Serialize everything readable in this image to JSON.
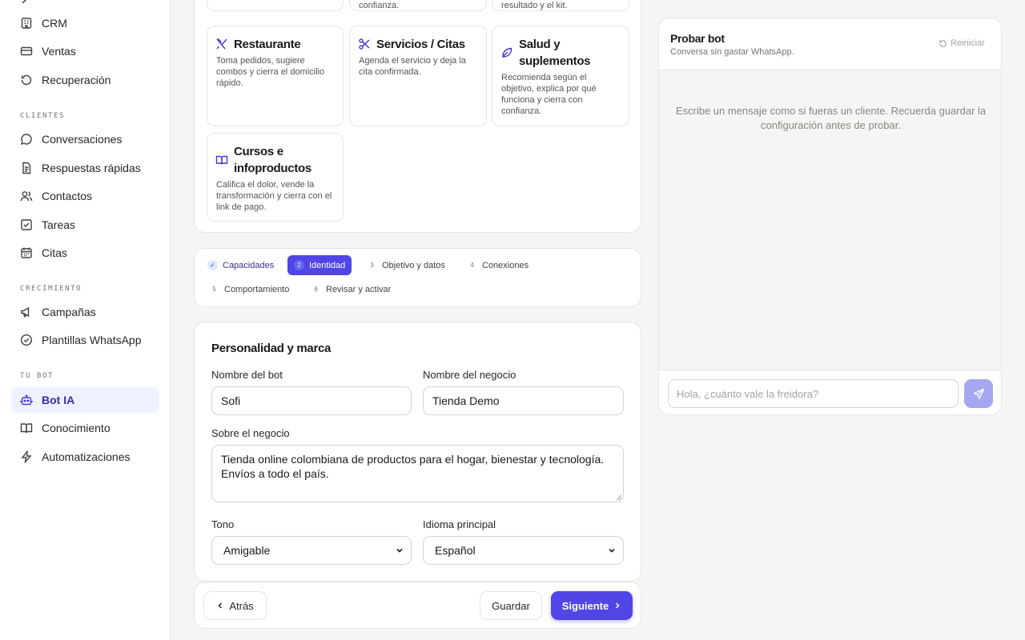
{
  "sidebar": {
    "items_top": [
      {
        "label": "CRM",
        "icon": "building-icon"
      },
      {
        "label": "Ventas",
        "icon": "card-icon"
      },
      {
        "label": "Recuperación",
        "icon": "refresh-icon"
      }
    ],
    "section_clientes": "CLIENTES",
    "items_clientes": [
      {
        "label": "Conversaciones",
        "icon": "chat-icon"
      },
      {
        "label": "Respuestas rápidas",
        "icon": "document-icon"
      },
      {
        "label": "Contactos",
        "icon": "users-icon"
      },
      {
        "label": "Tareas",
        "icon": "checkbox-icon"
      },
      {
        "label": "Citas",
        "icon": "calendar-icon"
      }
    ],
    "section_crecimiento": "CRECIMIENTO",
    "items_crecimiento": [
      {
        "label": "Campañas",
        "icon": "megaphone-icon"
      },
      {
        "label": "Plantillas WhatsApp",
        "icon": "check-circle-icon"
      }
    ],
    "section_tubot": "TU BOT",
    "items_tubot": [
      {
        "label": "Bot IA",
        "icon": "robot-icon",
        "active": true
      },
      {
        "label": "Conocimiento",
        "icon": "book-icon"
      },
      {
        "label": "Automatizaciones",
        "icon": "lightning-icon"
      }
    ]
  },
  "templates": {
    "top_partial": [
      {
        "desc_tail": "confianza."
      },
      {
        "desc_tail": "resultado y el kit."
      }
    ],
    "restaurante": {
      "title": "Restaurante",
      "desc": "Toma pedidos, sugiere combos y cierra el domicilio rápido."
    },
    "servicios": {
      "title": "Servicios / Citas",
      "desc": "Agenda el servicio y deja la cita confirmada."
    },
    "salud": {
      "title": "Salud y suplementos",
      "desc": "Recomienda según el objetivo, explica por qué funciona y cierra con confianza."
    },
    "cursos": {
      "title": "Cursos e infoproductos",
      "desc": "Califica el dolor, vende la transformación y cierra con el link de pago."
    }
  },
  "stepper": [
    {
      "num": "✓",
      "label": "Capacidades",
      "state": "done"
    },
    {
      "num": "2",
      "label": "Identidad",
      "state": "active"
    },
    {
      "num": "3",
      "label": "Objetivo y datos",
      "state": "todo"
    },
    {
      "num": "4",
      "label": "Conexiones",
      "state": "todo"
    },
    {
      "num": "5",
      "label": "Comportamiento",
      "state": "todo"
    },
    {
      "num": "6",
      "label": "Revisar y activar",
      "state": "todo"
    }
  ],
  "form": {
    "title": "Personalidad y marca",
    "bot_name_label": "Nombre del bot",
    "bot_name_value": "Sofi",
    "business_name_label": "Nombre del negocio",
    "business_name_value": "Tienda Demo",
    "about_label": "Sobre el negocio",
    "about_value": "Tienda online colombiana de productos para el hogar, bienestar y tecnología. Envíos a todo el país.",
    "tone_label": "Tono",
    "tone_value": "Amigable",
    "language_label": "Idioma principal",
    "language_value": "Español"
  },
  "actions": {
    "back": "Atrás",
    "save": "Guardar",
    "next": "Siguiente"
  },
  "test_panel": {
    "title": "Probar bot",
    "subtitle": "Conversa sin gastar WhatsApp.",
    "reset": "Reiniciar",
    "empty_hint": "Escribe un mensaje como si fueras un cliente. Recuerda guardar la configuración antes de probar.",
    "input_placeholder": "Hola, ¿cuánto vale la freidora?"
  },
  "colors": {
    "accent": "#4f46e5",
    "accent_light": "#eef2ff",
    "background": "#f5f5f4"
  }
}
